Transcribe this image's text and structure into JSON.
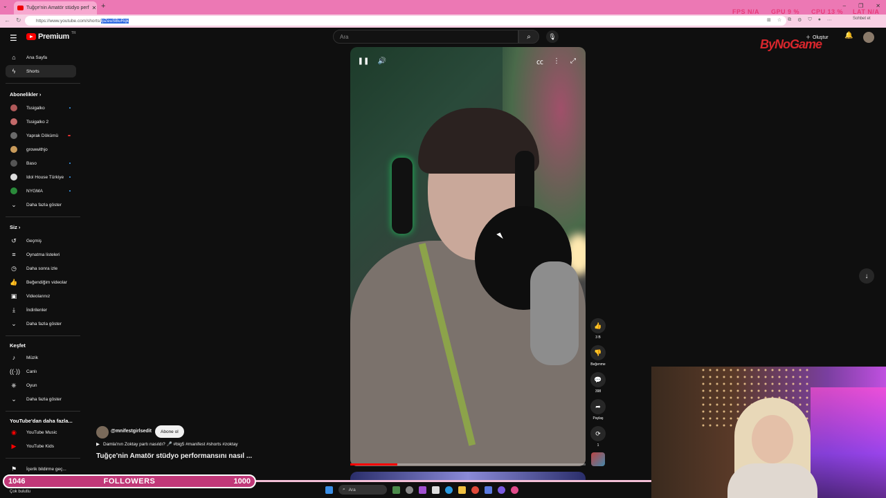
{
  "browser": {
    "tab_title": "Tuğçe'nin Amatör stüdyo perf",
    "tab_close": "✕",
    "new_tab": "+",
    "url_prefix": "https://www.youtube.com/shorts/",
    "url_selected": "fpZeuSBuRqk",
    "chat_button": "Sohbet et",
    "window_controls": [
      "–",
      "❐",
      "✕"
    ]
  },
  "hud": {
    "fps_label": "FPS",
    "fps_value": "N/A",
    "gpu_label": "GPU",
    "gpu_value": "9 %",
    "cpu_label": "CPU",
    "cpu_value": "13 %",
    "lat_label": "LAT",
    "lat_value": "N/A"
  },
  "header": {
    "logo_text": "Premium",
    "logo_region": "TR",
    "search_placeholder": "Ara",
    "create_label": "Oluştur",
    "watermark": "ByNoGame"
  },
  "sidebar": {
    "main": [
      {
        "label": "Ana Sayfa",
        "icon": "home-icon"
      },
      {
        "label": "Shorts",
        "icon": "shorts-icon"
      }
    ],
    "subs_heading": "Abonelikler",
    "subs": [
      {
        "label": "Tssigalko",
        "dot": true,
        "color": "#b05a5a"
      },
      {
        "label": "Tssigalko 2",
        "dot": false,
        "color": "#c46a6a"
      },
      {
        "label": "Yaprak Dökümü",
        "dot": false,
        "color": "#6a6a6a",
        "badge": true
      },
      {
        "label": "growwithjo",
        "dot": false,
        "color": "#c89a5a"
      },
      {
        "label": "Baso",
        "dot": true,
        "color": "#555"
      },
      {
        "label": "Idol House Türkiye",
        "dot": true,
        "color": "#ddd"
      },
      {
        "label": "NYGMA",
        "dot": true,
        "color": "#2a8a3a"
      }
    ],
    "subs_more": "Daha fazla göster",
    "you_heading": "Siz",
    "you": [
      {
        "label": "Geçmiş",
        "icon": "history-icon"
      },
      {
        "label": "Oynatma listeleri",
        "icon": "playlist-icon"
      },
      {
        "label": "Daha sonra izle",
        "icon": "clock-icon"
      },
      {
        "label": "Beğendiğim videolar",
        "icon": "like-icon"
      },
      {
        "label": "Videolarınız",
        "icon": "video-icon"
      },
      {
        "label": "İndirilenler",
        "icon": "download-icon"
      }
    ],
    "you_more": "Daha fazla göster",
    "explore_heading": "Keşfet",
    "explore": [
      {
        "label": "Müzik",
        "icon": "music-icon"
      },
      {
        "label": "Canlı",
        "icon": "live-icon"
      },
      {
        "label": "Oyun",
        "icon": "gaming-icon"
      }
    ],
    "explore_more": "Daha fazla göster",
    "more_yt_heading": "YouTube'dan daha fazla...",
    "more_yt": [
      {
        "label": "YouTube Music"
      },
      {
        "label": "YouTube Kids"
      }
    ],
    "report_history": "İçerik bildirme geç..."
  },
  "short": {
    "channel": "@mnifestgirlsedit",
    "subscribe": "Abone ol",
    "description": "Damla'nın Zoktay partı nasıldı? 🎤 #big5 #manifest #shorts #zoktay",
    "title": "Tuğçe'nin Amatör stüdyo performansını nasıl ...",
    "progress_fraction": 0.2,
    "like_count": "3 B",
    "dislike_label": "Beğenme",
    "comment_count": "398",
    "share_label": "Paylaş",
    "remix_count": "1"
  },
  "overlay": {
    "followers_current": "1046",
    "followers_label": "FOLLOWERS",
    "followers_goal": "1000",
    "status_text": "Çok bulutlu",
    "taskbar_search": "Ara"
  }
}
